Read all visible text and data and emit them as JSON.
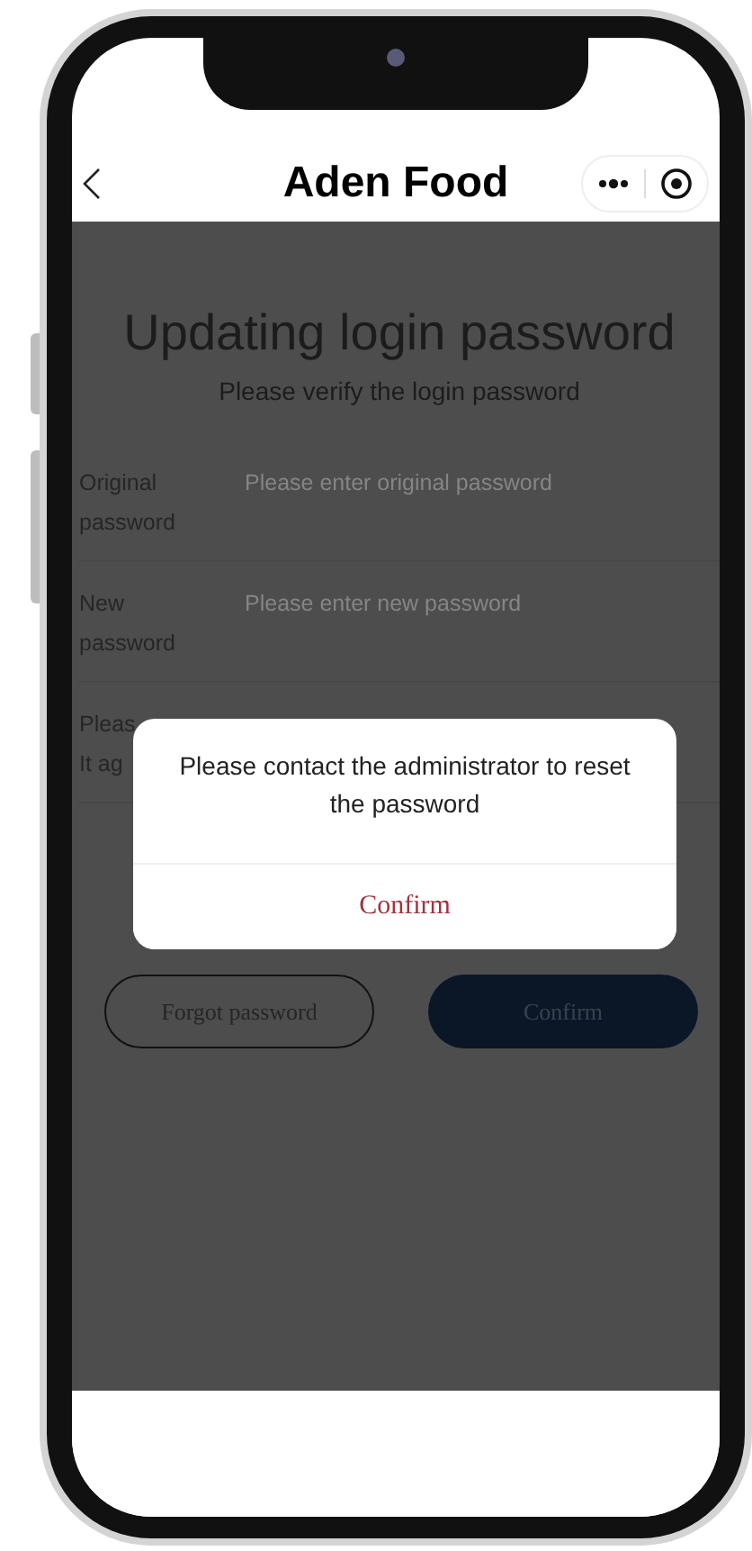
{
  "nav": {
    "title": "Aden Food"
  },
  "page": {
    "heading": "Updating login password",
    "subtitle": "Please verify the login password"
  },
  "fields": [
    {
      "label_lines": [
        "Original",
        "password"
      ],
      "placeholder": "Please enter original password"
    },
    {
      "label_lines": [
        "New",
        "password"
      ],
      "placeholder": "Please enter new password"
    },
    {
      "label_lines": [
        "Pleas",
        "It ag"
      ]
    }
  ],
  "buttons": [
    {
      "kind": "outline",
      "label": "Forgot password"
    },
    {
      "kind": "filled",
      "label": "Confirm"
    }
  ],
  "dialog": {
    "message": "Please contact the administrator to reset the password",
    "confirm": "Confirm"
  }
}
